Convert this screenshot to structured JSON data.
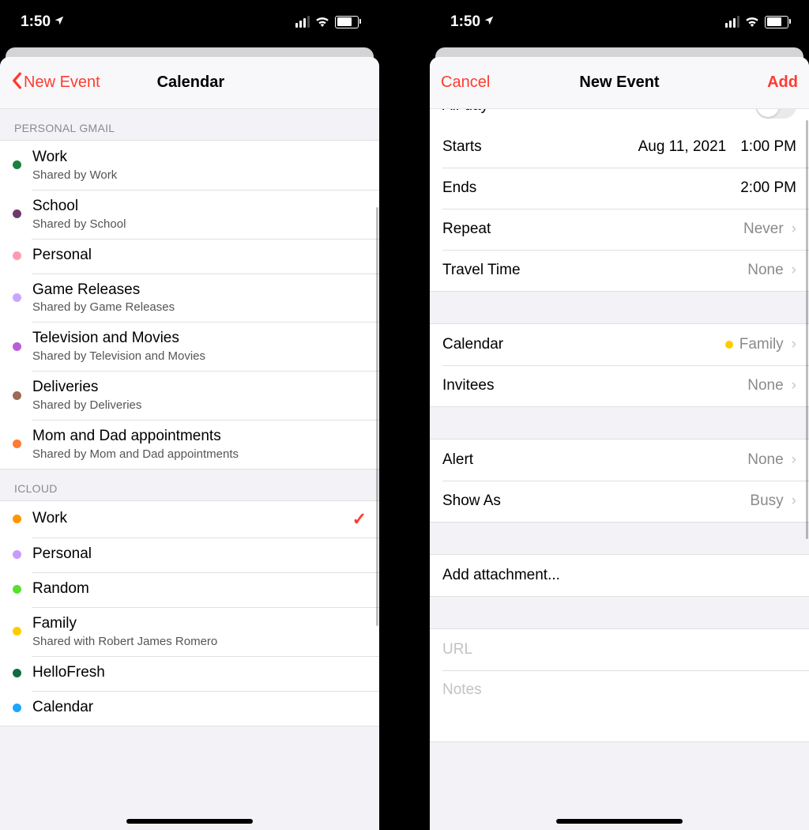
{
  "status": {
    "time": "1:50",
    "loc_icon": "➤"
  },
  "left": {
    "header": {
      "back_label": "New Event",
      "title": "Calendar"
    },
    "sections": [
      {
        "label": "PERSONAL GMAIL",
        "items": [
          {
            "name": "Work",
            "subtitle": "Shared by Work",
            "color": "#1e7f3d",
            "selected": false
          },
          {
            "name": "School",
            "subtitle": "Shared by School",
            "color": "#6e3a6e",
            "selected": false
          },
          {
            "name": "Personal",
            "subtitle": "",
            "color": "#ff9bb3",
            "selected": false
          },
          {
            "name": "Game Releases",
            "subtitle": "Shared by Game Releases",
            "color": "#c8a6ff",
            "selected": false
          },
          {
            "name": "Television and Movies",
            "subtitle": "Shared by Television and Movies",
            "color": "#b95ed6",
            "selected": false
          },
          {
            "name": "Deliveries",
            "subtitle": "Shared by Deliveries",
            "color": "#9b6b55",
            "selected": false
          },
          {
            "name": "Mom and Dad appointments",
            "subtitle": "Shared by Mom and Dad appointments",
            "color": "#ff7a33",
            "selected": false
          }
        ]
      },
      {
        "label": "ICLOUD",
        "items": [
          {
            "name": "Work",
            "subtitle": "",
            "color": "#ff9500",
            "selected": true
          },
          {
            "name": "Personal",
            "subtitle": "",
            "color": "#c69cff",
            "selected": false
          },
          {
            "name": "Random",
            "subtitle": "",
            "color": "#59e02d",
            "selected": false
          },
          {
            "name": "Family",
            "subtitle": "Shared with Robert James Romero",
            "color": "#ffcc00",
            "selected": false
          },
          {
            "name": "HelloFresh",
            "subtitle": "",
            "color": "#0f6e3e",
            "selected": false
          },
          {
            "name": "Calendar",
            "subtitle": "",
            "color": "#1ca6ff",
            "selected": false
          }
        ]
      }
    ]
  },
  "right": {
    "header": {
      "cancel_label": "Cancel",
      "title": "New Event",
      "add_label": "Add"
    },
    "allday": {
      "label": "All-day",
      "on": false
    },
    "rows": {
      "starts": {
        "label": "Starts",
        "date": "Aug 11, 2021",
        "time": "1:00 PM"
      },
      "ends": {
        "label": "Ends",
        "time": "2:00 PM"
      },
      "repeat": {
        "label": "Repeat",
        "value": "Never"
      },
      "travel": {
        "label": "Travel Time",
        "value": "None"
      },
      "calendar": {
        "label": "Calendar",
        "value": "Family",
        "color": "#ffcc00"
      },
      "invitees": {
        "label": "Invitees",
        "value": "None"
      },
      "alert": {
        "label": "Alert",
        "value": "None"
      },
      "showas": {
        "label": "Show As",
        "value": "Busy"
      },
      "attach": {
        "label": "Add attachment..."
      },
      "url": {
        "placeholder": "URL"
      },
      "notes": {
        "placeholder": "Notes"
      }
    }
  }
}
